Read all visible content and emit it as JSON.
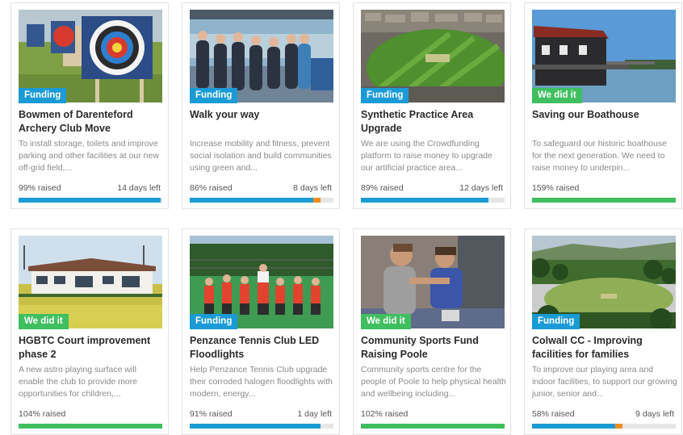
{
  "colors": {
    "funding": "#1a9bd6",
    "we_did_it": "#3fbf5f",
    "bar_blue": "#1a9bd6",
    "bar_green": "#3fbf5f",
    "bar_orange": "#f28c1b"
  },
  "cards": [
    {
      "badge": "Funding",
      "title": "Bowmen of Darenteford Archery Club Move",
      "desc": "To install storage, toilets and improve parking and other facilities at our new off-grid field,...",
      "raised": "99% raised",
      "days_left": "14 days left",
      "progress": 0.99,
      "status": "funding",
      "image": "archery-targets"
    },
    {
      "badge": "Funding",
      "title": "Walk your way",
      "desc": "Increase mobility and fitness, prevent social isolation and build communities using green and...",
      "raised": "86% raised",
      "days_left": "8 days left",
      "progress": 0.86,
      "status": "funding",
      "image": "group-walkers"
    },
    {
      "badge": "Funding",
      "title": "Synthetic Practice Area Upgrade",
      "desc": "We are using the Crowdfunding platform to raise money to upgrade our artificial practice area...",
      "raised": "89% raised",
      "days_left": "12 days left",
      "progress": 0.89,
      "status": "funding",
      "image": "cricket-ground-aerial"
    },
    {
      "badge": "We did it",
      "title": "Saving our Boathouse",
      "desc": "To safeguard our historic boathouse for the next generation. We need to raise money to underpin...",
      "raised": "159% raised",
      "days_left": "",
      "progress": 1.59,
      "status": "success",
      "image": "boathouse"
    },
    {
      "badge": "We did it",
      "title": "HGBTC Court improvement phase 2",
      "desc": "A new astro playing surface will enable the club to provide more opportunities for children,...",
      "raised": "104% raised",
      "days_left": "",
      "progress": 1.04,
      "status": "success",
      "image": "clubhouse-court"
    },
    {
      "badge": "Funding",
      "title": "Penzance Tennis Club LED Floodlights",
      "desc": "Help Penzance Tennis Club upgrade their corroded halogen floodlights with modern, energy...",
      "raised": "91% raised",
      "days_left": "1 day left",
      "progress": 0.91,
      "status": "funding",
      "image": "tennis-kids"
    },
    {
      "badge": "We did it",
      "title": "Community Sports Fund Raising Poole",
      "desc": "Community sports centre for the people of Poole to help physical health and wellbeing including...",
      "raised": "102% raised",
      "days_left": "",
      "progress": 1.02,
      "status": "success",
      "image": "martial-arts-kids"
    },
    {
      "badge": "Funding",
      "title": "Colwall CC - Improving facilities for families",
      "desc": "To improve our playing area and indoor facilities, to support our growing junior, senior and...",
      "raised": "58% raised",
      "days_left": "9 days left",
      "progress": 0.58,
      "status": "funding",
      "image": "cricket-field-hills"
    }
  ]
}
